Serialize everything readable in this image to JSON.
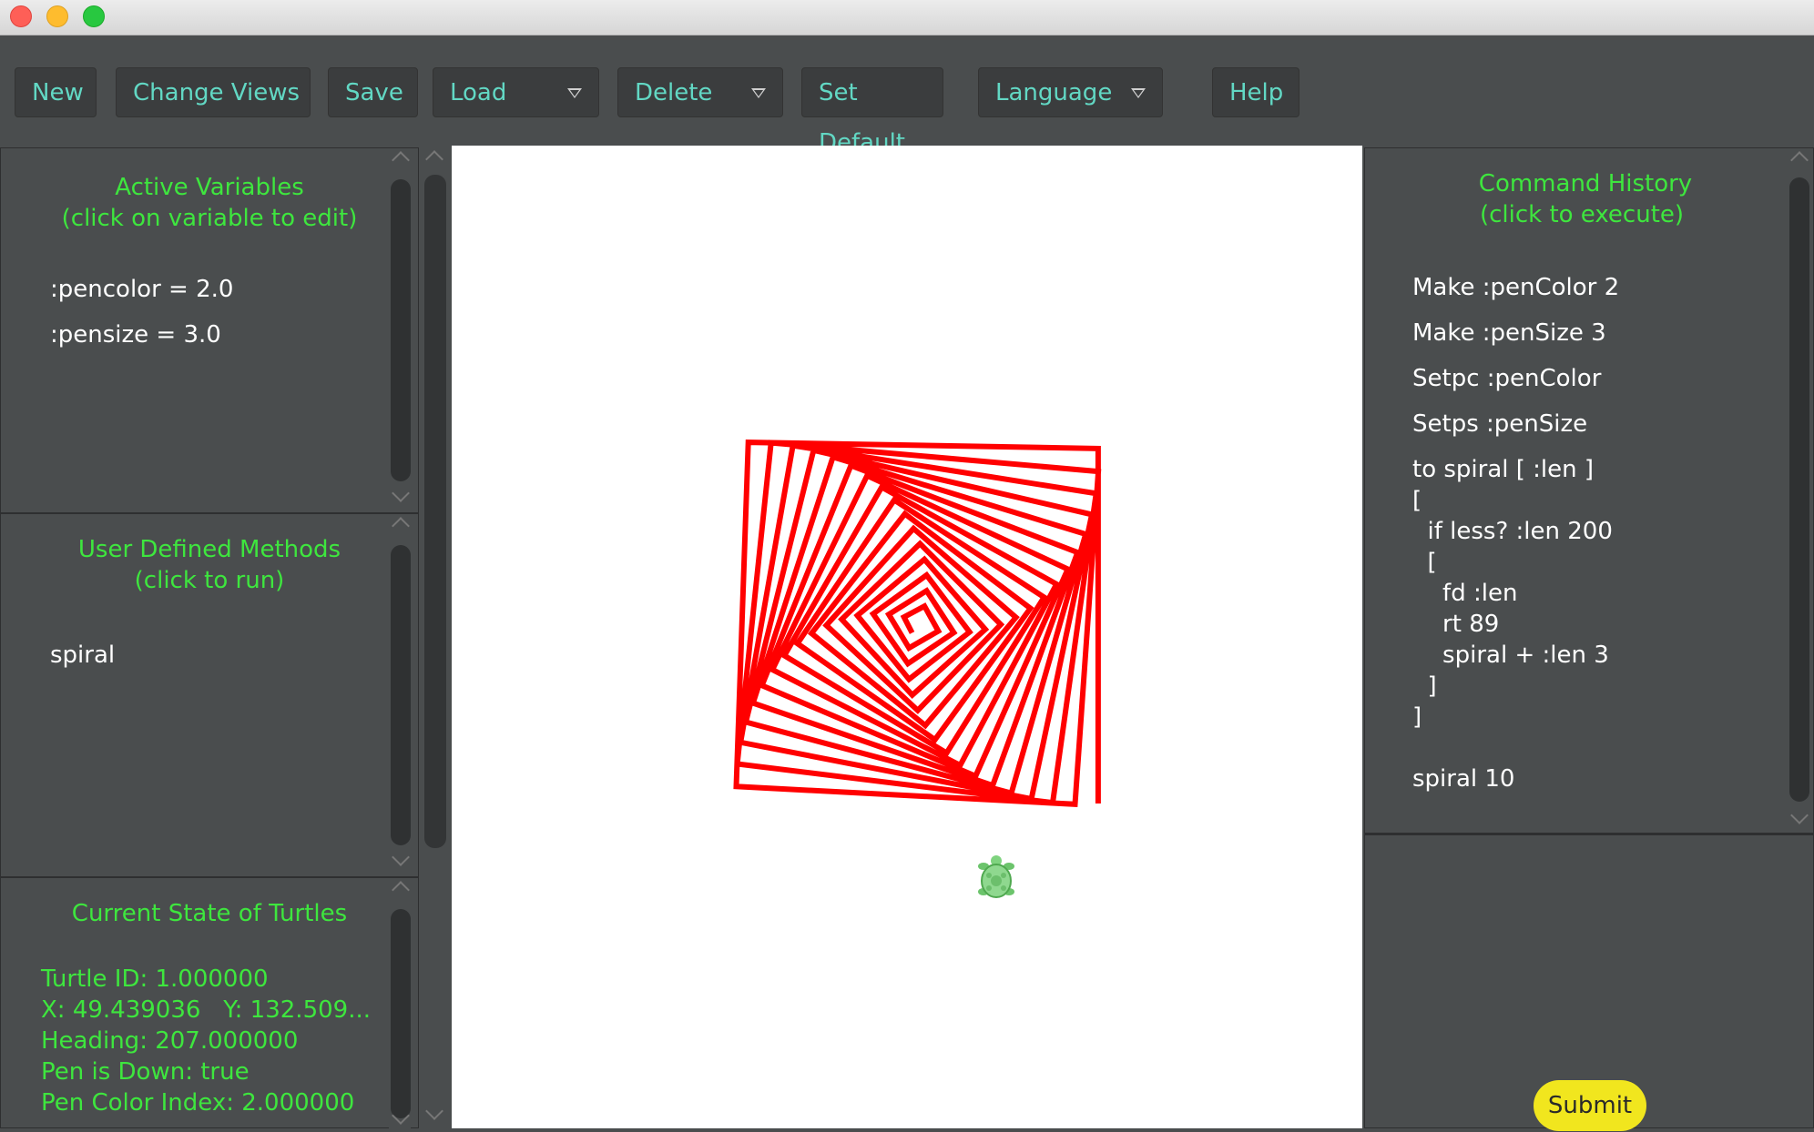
{
  "toolbar": {
    "new": "New",
    "change_views": "Change Views",
    "save": "Save",
    "load": "Load",
    "delete": "Delete",
    "set_default": "Set Default",
    "language": "Language",
    "help": "Help"
  },
  "variables_panel": {
    "title_line1": "Active Variables",
    "title_line2": "(click on variable to edit)",
    "items": [
      ":pencolor = 2.0",
      ":pensize = 3.0"
    ]
  },
  "methods_panel": {
    "title_line1": "User Defined Methods",
    "title_line2": "(click to run)",
    "items": [
      "spiral"
    ]
  },
  "turtle_panel": {
    "title": "Current State of Turtles",
    "lines": [
      "Turtle ID: 1.000000",
      "X: 49.439036   Y: 132.509...",
      "Heading: 207.000000",
      "Pen is Down: true",
      "Pen Color Index: 2.000000"
    ]
  },
  "history_panel": {
    "title_line1": "Command History",
    "title_line2": "(click to execute)",
    "commands": [
      "Make :penColor 2",
      "Make :penSize 3",
      "Setpc :penColor",
      "Setps :penSize",
      "to spiral [ :len ]",
      "[",
      "  if less? :len 200",
      "  [",
      "    fd :len",
      "    rt 89",
      "    spiral + :len 3",
      "  ]",
      "]",
      "spiral 10"
    ]
  },
  "submit_label": "Submit",
  "colors": {
    "pen": "#ff0000",
    "accent": "#3ee63e",
    "button_text": "#62d8c4",
    "submit": "#f1e61e"
  },
  "icons": {
    "turtle": "turtle-icon"
  }
}
